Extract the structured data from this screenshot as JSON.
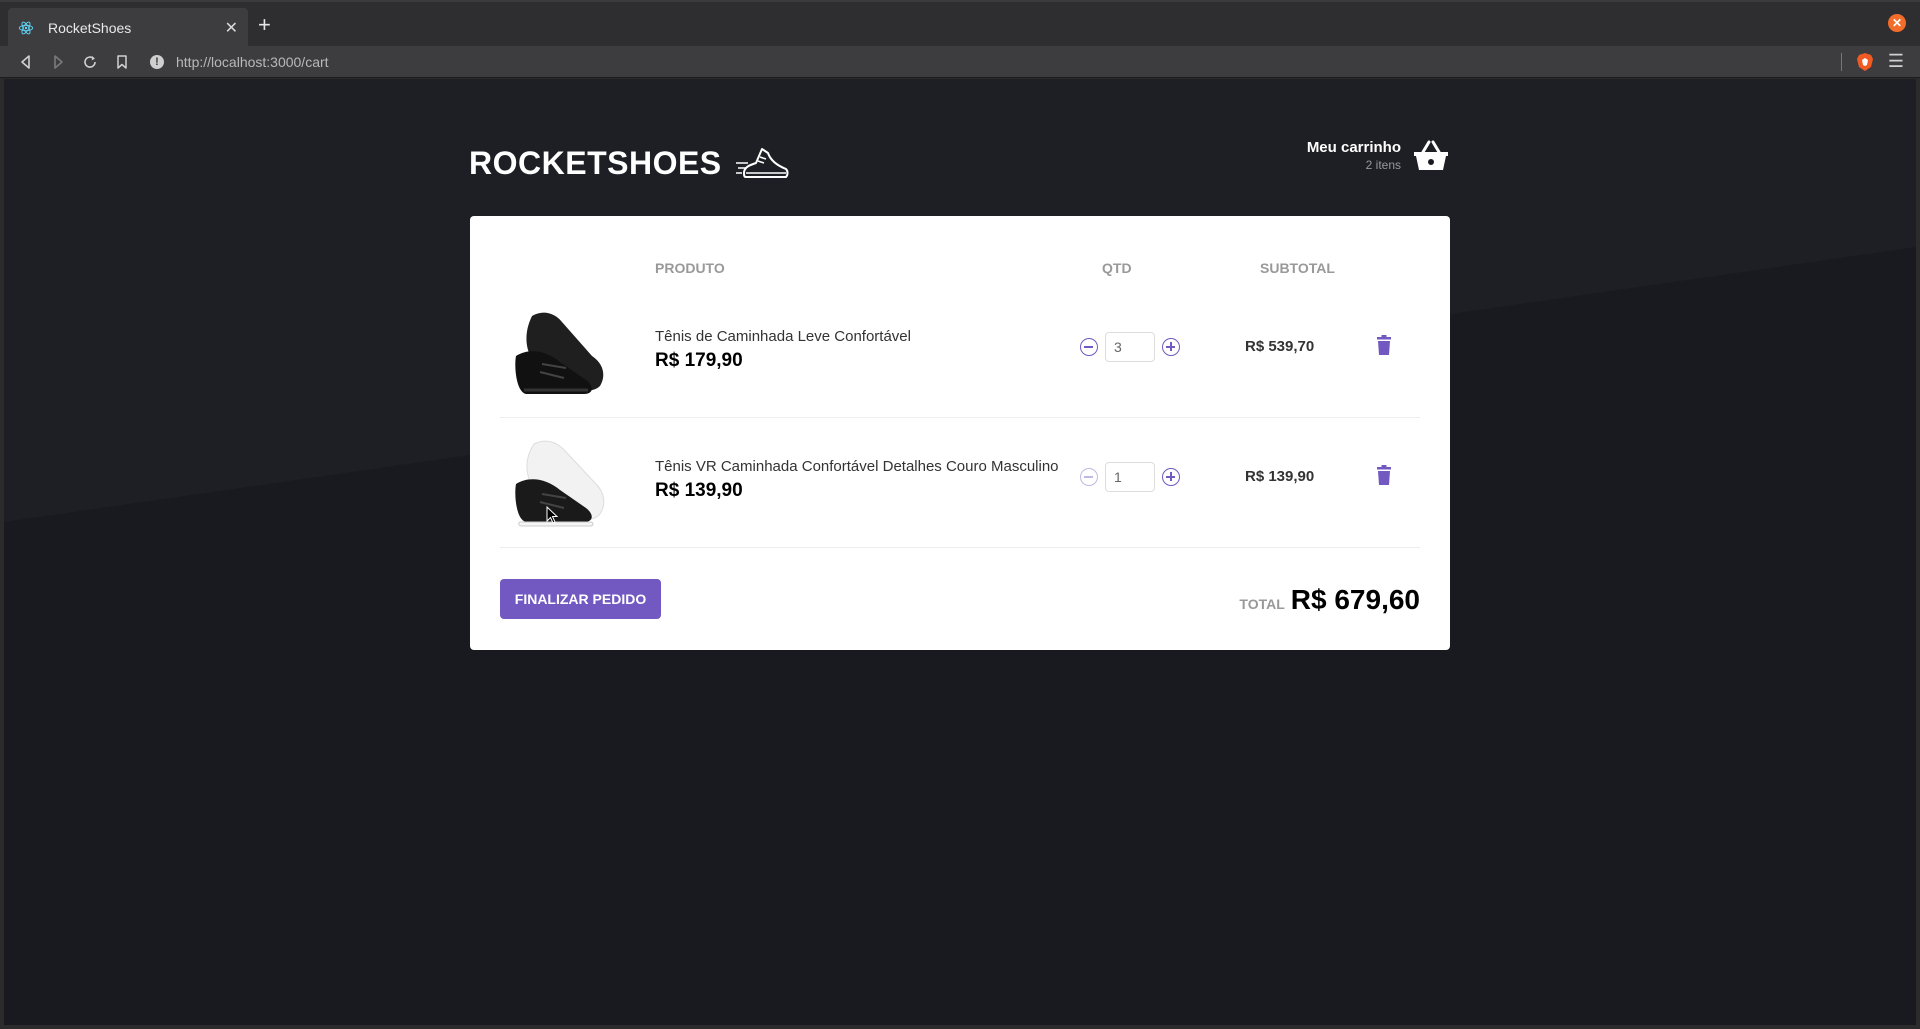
{
  "browser": {
    "tab_title": "RocketShoes",
    "new_tab_symbol": "+",
    "url": "http://localhost:3000/cart"
  },
  "header": {
    "logo_text": "ROCKETSHOES",
    "cart_title": "Meu carrinho",
    "cart_count": "2 itens"
  },
  "table": {
    "col_product": "PRODUTO",
    "col_qty": "QTD",
    "col_subtotal": "SUBTOTAL"
  },
  "items": [
    {
      "name": "Tênis de Caminhada Leve Confortável",
      "price": "R$ 179,90",
      "qty": "3",
      "subtotal": "R$ 539,70",
      "sole_color": "#222222"
    },
    {
      "name": "Tênis VR Caminhada Confortável Detalhes Couro Masculino",
      "price": "R$ 139,90",
      "qty": "1",
      "subtotal": "R$ 139,90",
      "sole_color": "#f4f4f4"
    }
  ],
  "footer": {
    "checkout_label": "FINALIZAR PEDIDO",
    "total_label": "TOTAL",
    "total_value": "R$ 679,60"
  },
  "colors": {
    "accent": "#7159c1",
    "page_bg": "#191920",
    "card_bg": "#ffffff"
  }
}
